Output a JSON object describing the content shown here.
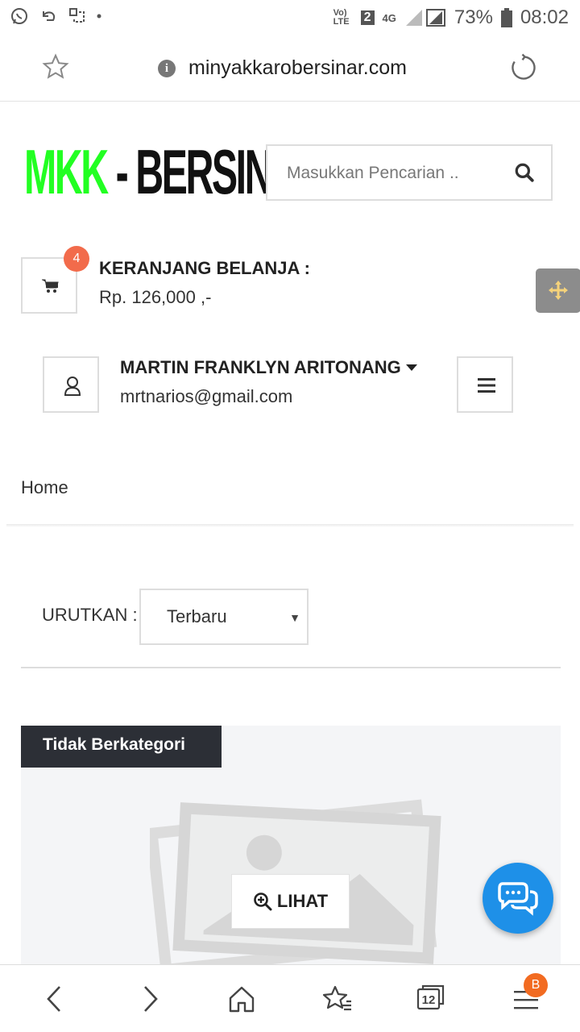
{
  "status_bar": {
    "signal_label": "Vo) LTE",
    "sim_label": "2",
    "network_label": "4G",
    "battery": "73%",
    "time": "08:02"
  },
  "browser": {
    "url": "minyakkarobersinar.com"
  },
  "header": {
    "logo_green": "MKK",
    "logo_dark": " - BERSINAR",
    "search_placeholder": "Masukkan Pencarian .."
  },
  "cart": {
    "badge": "4",
    "title": "KERANJANG BELANJA :",
    "total": "Rp. 126,000 ,-"
  },
  "user": {
    "name": "MARTIN FRANKLYN ARITONANG",
    "email": "mrtnarios@gmail.com"
  },
  "breadcrumb": {
    "home": "Home"
  },
  "sort": {
    "label": "URUTKAN :",
    "selected": "Terbaru"
  },
  "product": {
    "category": "Tidak Berkategori",
    "view_label": "LIHAT"
  },
  "bottom_nav": {
    "tabs_count": "12",
    "menu_badge": "B"
  },
  "colors": {
    "logo_green": "#22ff22",
    "badge_orange": "#f26b4b",
    "chat_blue": "#1e90e8",
    "tag_dark": "#2c2f36"
  }
}
